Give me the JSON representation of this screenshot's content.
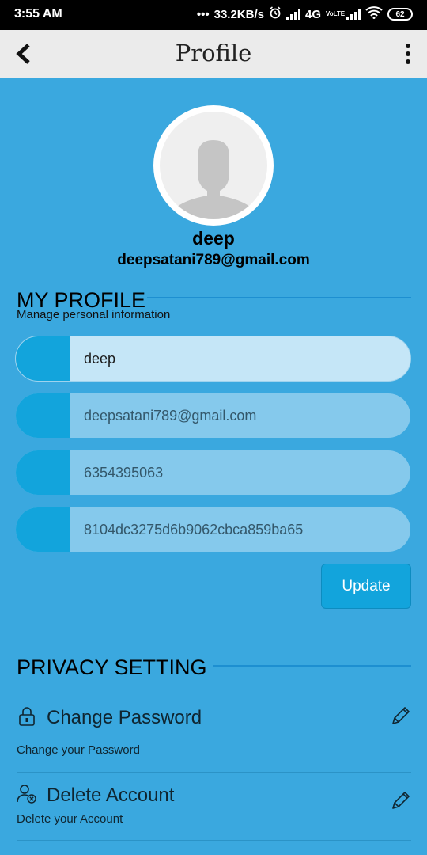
{
  "status_bar": {
    "time": "3:55 AM",
    "dots": "•••",
    "speed": "33.2KB/s",
    "network": "4G",
    "volte": "VoLTE",
    "battery": "62",
    "icons": [
      "alarm-icon",
      "signal-icon",
      "volte-icon",
      "wifi-icon",
      "battery-icon"
    ]
  },
  "app_bar": {
    "title": "Profile",
    "back_icon": "chevron-left-icon",
    "menu_icon": "more-vert-icon"
  },
  "profile": {
    "name": "deep",
    "email": "deepsatani789@gmail.com"
  },
  "my_profile": {
    "title": "MY PROFILE",
    "subtitle": "Manage personal information",
    "fields": [
      {
        "value": "deep",
        "focused": true
      },
      {
        "value": "deepsatani789@gmail.com",
        "focused": false
      },
      {
        "value": "6354395063",
        "focused": false
      },
      {
        "value": "8104dc3275d6b9062cbca859ba65",
        "focused": false
      }
    ],
    "update_label": "Update"
  },
  "privacy": {
    "title": "PRIVACY SETTING",
    "items": [
      {
        "label": "Change Password",
        "subtitle": "Change your Password",
        "icon": "lock-icon",
        "action_icon": "pencil-icon"
      },
      {
        "label": "Delete Account",
        "subtitle": "Delete your Account",
        "icon": "user-remove-icon",
        "action_icon": "pencil-icon"
      }
    ]
  },
  "colors": {
    "background": "#3aa8df",
    "app_bar": "#ebebeb",
    "accent": "#12a4dc",
    "field": "#85c9ec",
    "field_focused": "#c5e6f7"
  }
}
